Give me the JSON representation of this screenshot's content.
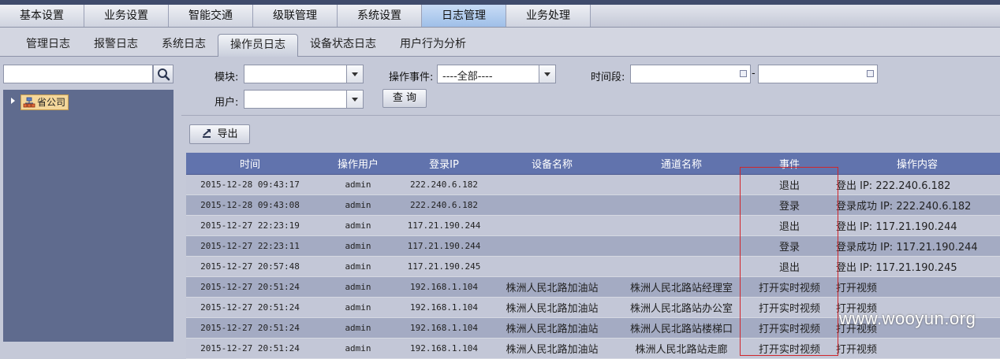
{
  "top_nav": {
    "tabs": [
      {
        "label": "基本设置"
      },
      {
        "label": "业务设置"
      },
      {
        "label": "智能交通"
      },
      {
        "label": "级联管理"
      },
      {
        "label": "系统设置"
      },
      {
        "label": "日志管理"
      },
      {
        "label": "业务处理"
      }
    ],
    "active_index": 5
  },
  "sub_nav": {
    "tabs": [
      {
        "label": "管理日志"
      },
      {
        "label": "报警日志"
      },
      {
        "label": "系统日志"
      },
      {
        "label": "操作员日志"
      },
      {
        "label": "设备状态日志"
      },
      {
        "label": "用户行为分析"
      }
    ],
    "active_index": 3
  },
  "sidebar": {
    "search_value": "",
    "tree_root": "省公司",
    "search_icon": "search-icon",
    "tree_icon": "org-tree-icon"
  },
  "filters": {
    "module_label": "模块:",
    "module_value": "",
    "event_label": "操作事件:",
    "event_value": "----全部----",
    "period_label": "时间段:",
    "period_separator": "-",
    "start_value": "",
    "end_value": "",
    "user_label": "用户:",
    "user_value": "",
    "query_button": "查 询"
  },
  "toolbar": {
    "export_button": "导出",
    "export_icon": "export-icon"
  },
  "table": {
    "columns": [
      "时间",
      "操作用户",
      "登录IP",
      "设备名称",
      "通道名称",
      "事件",
      "操作内容"
    ],
    "rows": [
      {
        "time": "2015-12-28 09:43:17",
        "user": "admin",
        "ip": "222.240.6.182",
        "device": "",
        "channel": "",
        "event": "退出",
        "content": "登出 IP: 222.240.6.182"
      },
      {
        "time": "2015-12-28 09:43:08",
        "user": "admin",
        "ip": "222.240.6.182",
        "device": "",
        "channel": "",
        "event": "登录",
        "content": "登录成功 IP: 222.240.6.182"
      },
      {
        "time": "2015-12-27 22:23:19",
        "user": "admin",
        "ip": "117.21.190.244",
        "device": "",
        "channel": "",
        "event": "退出",
        "content": "登出 IP: 117.21.190.244"
      },
      {
        "time": "2015-12-27 22:23:11",
        "user": "admin",
        "ip": "117.21.190.244",
        "device": "",
        "channel": "",
        "event": "登录",
        "content": "登录成功 IP: 117.21.190.244"
      },
      {
        "time": "2015-12-27 20:57:48",
        "user": "admin",
        "ip": "117.21.190.245",
        "device": "",
        "channel": "",
        "event": "退出",
        "content": "登出 IP: 117.21.190.245"
      },
      {
        "time": "2015-12-27 20:51:24",
        "user": "admin",
        "ip": "192.168.1.104",
        "device": "株洲人民北路加油站",
        "channel": "株洲人民北路站经理室",
        "event": "打开实时视频",
        "content": "打开视频"
      },
      {
        "time": "2015-12-27 20:51:24",
        "user": "admin",
        "ip": "192.168.1.104",
        "device": "株洲人民北路加油站",
        "channel": "株洲人民北路站办公室",
        "event": "打开实时视频",
        "content": "打开视频"
      },
      {
        "time": "2015-12-27 20:51:24",
        "user": "admin",
        "ip": "192.168.1.104",
        "device": "株洲人民北路加油站",
        "channel": "株洲人民北路站楼梯口",
        "event": "打开实时视频",
        "content": "打开视频"
      },
      {
        "time": "2015-12-27 20:51:24",
        "user": "admin",
        "ip": "192.168.1.104",
        "device": "株洲人民北路加油站",
        "channel": "株洲人民北路站走廊",
        "event": "打开实时视频",
        "content": "打开视频"
      }
    ]
  },
  "watermark": "www.wooyun.org",
  "colors": {
    "header_bg": "#6173ad",
    "active_tab": "#9fbfe8",
    "row_light": "#c3c7d7",
    "row_dark": "#a4abc3",
    "highlight_box": "#d0262b"
  }
}
